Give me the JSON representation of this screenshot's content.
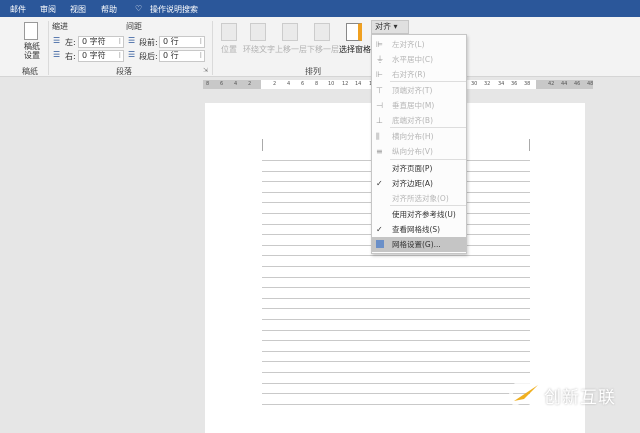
{
  "tabs": [
    "邮件",
    "审阅",
    "视图",
    "帮助",
    "操作说明搜索"
  ],
  "ribbon": {
    "manuscript": {
      "button": "稿纸\n设置",
      "group": "稿纸"
    },
    "indent": {
      "title": "缩进",
      "left_label": "左:",
      "left_value": "0 字符",
      "right_label": "右:",
      "right_value": "0 字符"
    },
    "spacing": {
      "title": "间距",
      "before_label": "段前:",
      "before_value": "0 行",
      "after_label": "段后:",
      "after_value": "0 行"
    },
    "paragraph_group": "段落",
    "arrange": {
      "position": "位置",
      "wrap": "环绕文字",
      "forward": "上移一层",
      "backward": "下移一层",
      "selection_pane": "选择窗格",
      "align": "对齐",
      "group": "排列"
    }
  },
  "ruler": {
    "left": [
      "8",
      "6",
      "4",
      "2"
    ],
    "right": [
      "2",
      "4",
      "6",
      "8",
      "10",
      "12",
      "14",
      "16"
    ],
    "right2": [
      "30",
      "32",
      "34",
      "36",
      "38"
    ],
    "margin": [
      "42",
      "44",
      "46",
      "48"
    ]
  },
  "menu": {
    "items": [
      {
        "label": "左对齐(L)",
        "disabled": true,
        "icon": "align-left-icon"
      },
      {
        "label": "水平居中(C)",
        "disabled": true,
        "icon": "align-center-icon"
      },
      {
        "label": "右对齐(R)",
        "disabled": true,
        "icon": "align-right-icon"
      },
      {
        "label": "顶端对齐(T)",
        "disabled": true,
        "icon": "align-top-icon"
      },
      {
        "label": "垂直居中(M)",
        "disabled": true,
        "icon": "align-middle-icon"
      },
      {
        "label": "底端对齐(B)",
        "disabled": true,
        "icon": "align-bottom-icon"
      },
      {
        "label": "横向分布(H)",
        "disabled": true,
        "icon": "distribute-horizontal-icon"
      },
      {
        "label": "纵向分布(V)",
        "disabled": true,
        "icon": "distribute-vertical-icon"
      },
      {
        "label": "对齐页面(P)",
        "disabled": false
      },
      {
        "label": "对齐边距(A)",
        "disabled": false,
        "checked": true
      },
      {
        "label": "对齐所选对象(O)",
        "disabled": true
      },
      {
        "label": "使用对齐参考线(U)",
        "disabled": false
      },
      {
        "label": "查看网格线(S)",
        "disabled": false,
        "checked": true
      },
      {
        "label": "网格设置(G)...",
        "disabled": false,
        "highlighted": true
      }
    ]
  },
  "watermark": "创新互联"
}
